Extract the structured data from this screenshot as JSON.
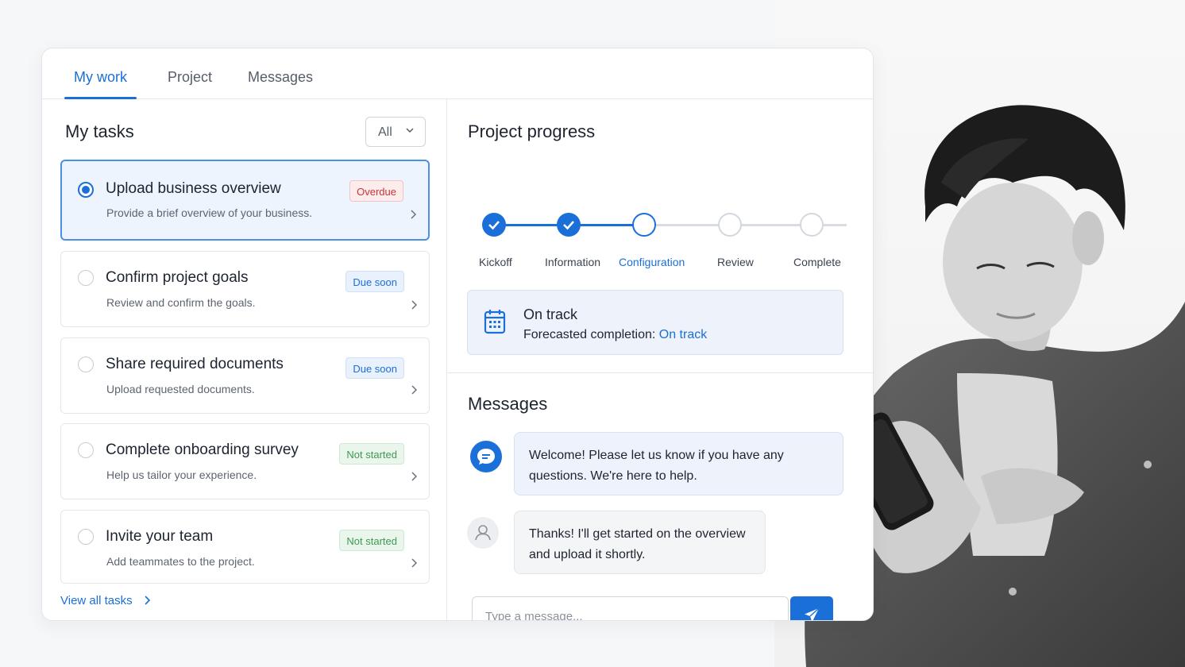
{
  "tabs": [
    {
      "label": "My work",
      "active": true
    },
    {
      "label": "Project",
      "active": false
    },
    {
      "label": "Messages",
      "active": false
    }
  ],
  "tasks_panel": {
    "title": "My tasks",
    "filter_value": "All",
    "view_all_label": "View all tasks"
  },
  "tasks": [
    {
      "title": "Upload business overview",
      "subtitle": "Provide a brief overview of your business.",
      "status": "Overdue",
      "status_kind": "overdue",
      "selected": true
    },
    {
      "title": "Confirm project goals",
      "subtitle": "Review and confirm the goals.",
      "status": "Due soon",
      "status_kind": "soon",
      "selected": false
    },
    {
      "title": "Share required documents",
      "subtitle": "Upload requested documents.",
      "status": "Due soon",
      "status_kind": "soon",
      "selected": false
    },
    {
      "title": "Complete onboarding survey",
      "subtitle": "Help us tailor your experience.",
      "status": "Not started",
      "status_kind": "notstarted",
      "selected": false
    },
    {
      "title": "Invite your team",
      "subtitle": "Add teammates to the project.",
      "status": "Not started",
      "status_kind": "notstarted",
      "selected": false
    }
  ],
  "progress": {
    "title": "Project progress",
    "steps": [
      {
        "label": "Kickoff",
        "state": "done"
      },
      {
        "label": "Information",
        "state": "done"
      },
      {
        "label": "Configuration",
        "state": "current"
      },
      {
        "label": "Review",
        "state": "todo"
      },
      {
        "label": "Complete",
        "state": "todo"
      }
    ],
    "status_title": "On track",
    "forecast_label": "Forecasted completion:",
    "forecast_value": "On track"
  },
  "messages": {
    "title": "Messages",
    "bot_message": "Welcome! Please let us know if you have any questions. We're here to help.",
    "user_message": "Thanks! I'll get started on the overview and upload it shortly.",
    "input_placeholder": "Type a message..."
  },
  "colors": {
    "accent": "#1a6fd8",
    "overdue": "#c8333a",
    "due_soon": "#1a6fd8",
    "not_started": "#3e9a50"
  },
  "icons": [
    "chevron-down-icon",
    "chevron-right-icon",
    "check-icon",
    "calendar-icon",
    "chat-bubble-icon",
    "user-icon",
    "send-icon"
  ]
}
